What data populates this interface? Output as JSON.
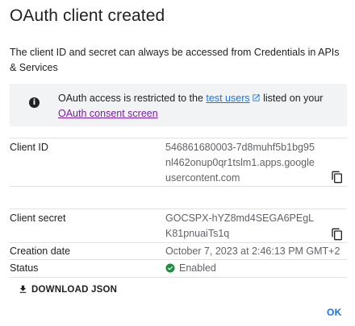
{
  "dialog": {
    "title": "OAuth client created",
    "intro": "The client ID and secret can always be accessed from Credentials in APIs & Services"
  },
  "info": {
    "icon": "info-icon",
    "text_before": "OAuth access is restricted to the ",
    "test_users_link": "test users",
    "external_icon": "open-in-new-icon",
    "text_after": " listed on your ",
    "consent_link": "OAuth consent screen"
  },
  "fields": {
    "client_id": {
      "label": "Client ID",
      "value": "546861680003-7d8muhf5b1bg95nl462onup0qr1tslm1.apps.googleusercontent.com",
      "copy_icon": "copy-icon"
    },
    "client_secret": {
      "label": "Client secret",
      "value": "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",
      "copy_icon": "copy-icon"
    },
    "creation_date": {
      "label": "Creation date",
      "value": "October 7, 2023 at 2:46:13 PM GMT+2"
    },
    "status": {
      "label": "Status",
      "value": "Enabled",
      "icon": "check-circle-icon",
      "color": "#1e8e3e"
    }
  },
  "actions": {
    "download_label": "DOWNLOAD JSON",
    "download_icon": "download-icon",
    "ok_label": "OK"
  },
  "colors": {
    "link": "#1a73e8",
    "visited_link": "#7b1fa2",
    "info_bg": "#f1f3f4",
    "secondary_text": "#5f6368"
  }
}
